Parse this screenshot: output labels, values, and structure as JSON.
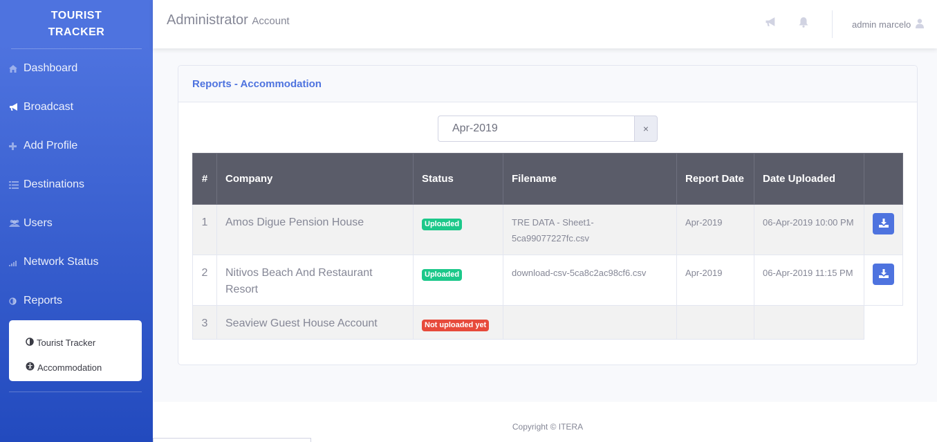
{
  "sidebar": {
    "brand_line1": "TOURIST",
    "brand_line2": "TRACKER",
    "items": [
      {
        "label": "Dashboard",
        "icon": "home-icon"
      },
      {
        "label": "Broadcast",
        "icon": "bullhorn-icon"
      },
      {
        "label": "Add Profile",
        "icon": "plus-icon"
      },
      {
        "label": "Destinations",
        "icon": "list-icon"
      },
      {
        "label": "Users",
        "icon": "users-icon"
      },
      {
        "label": "Network Status",
        "icon": "signal-icon"
      },
      {
        "label": "Reports",
        "icon": "half-circle-icon"
      }
    ],
    "submenu": [
      {
        "label": "Tourist Tracker",
        "icon": "half-circle-icon"
      },
      {
        "label": "Accommodation",
        "icon": "accessibility-icon"
      }
    ]
  },
  "topbar": {
    "title": "Administrator",
    "subtitle": "Account",
    "user_name": "admin marcelo"
  },
  "card": {
    "header": "Reports - Accommodation",
    "filter_value": "Apr-2019",
    "clear_label": "×"
  },
  "table": {
    "headers": [
      "#",
      "Company",
      "Status",
      "Filename",
      "Report Date",
      "Date Uploaded",
      ""
    ],
    "rows": [
      {
        "num": "1",
        "company": "Amos Digue Pension House",
        "status": "Uploaded",
        "filename": "TRE DATA - Sheet1-5ca99077227fc.csv",
        "report_date": "Apr-2019",
        "date_uploaded": "06-Apr-2019 10:00 PM"
      },
      {
        "num": "2",
        "company": "Nitivos Beach And Restaurant Resort",
        "status": "Uploaded",
        "filename": "download-csv-5ca8c2ac98cf6.csv",
        "report_date": "Apr-2019",
        "date_uploaded": "06-Apr-2019 11:15 PM"
      },
      {
        "num": "3",
        "company": "Seaview Guest House Account",
        "status": "Not uploaded yet",
        "filename": "",
        "report_date": "",
        "date_uploaded": ""
      }
    ]
  },
  "footer": {
    "copyright": "Copyright © ITERA"
  },
  "colors": {
    "primary": "#4e73df",
    "success": "#1cc88a",
    "danger": "#e74a3b",
    "table_header": "#5a5c69"
  }
}
